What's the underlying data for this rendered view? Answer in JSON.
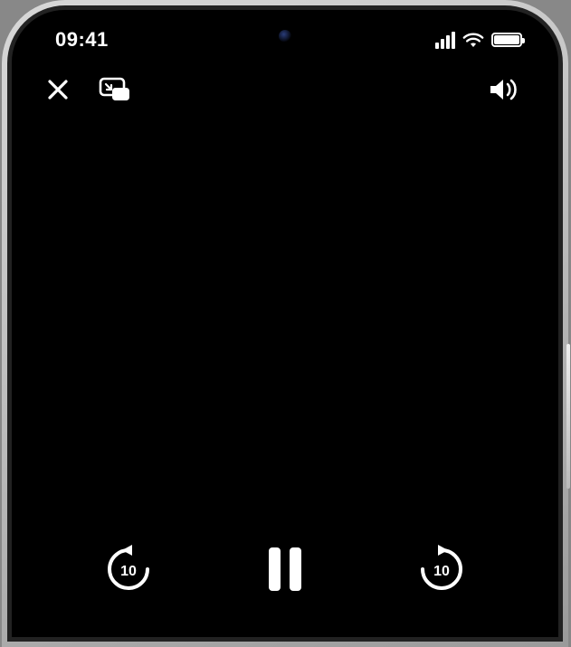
{
  "status": {
    "time": "09:41"
  },
  "controls": {
    "skip_back_label": "10",
    "skip_forward_label": "10"
  }
}
